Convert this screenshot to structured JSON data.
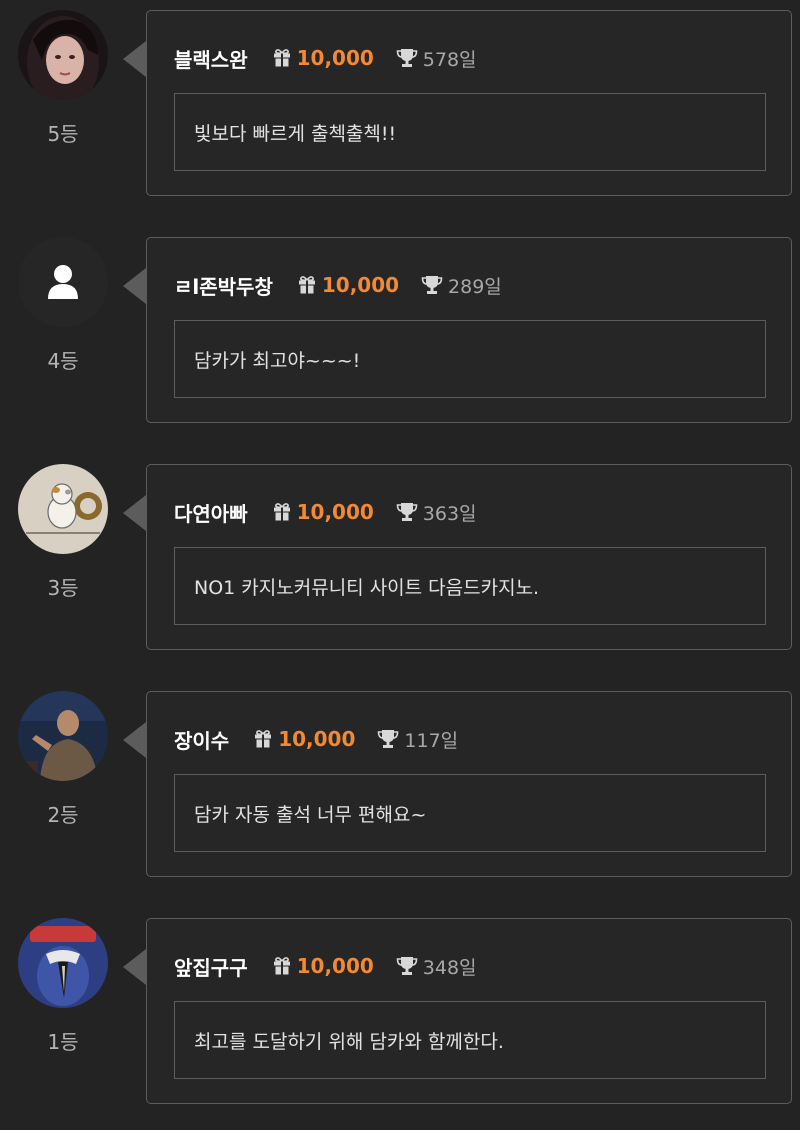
{
  "entries": [
    {
      "nickname": "블랙스완",
      "points": "10,000",
      "days": "578일",
      "message": "빛보다 빠르게 출첵출첵!!",
      "rank": "5등",
      "avatar": "photo-avatar"
    },
    {
      "nickname": "ㄹl존박두창",
      "points": "10,000",
      "days": "289일",
      "message": "담카가 최고야~~~!",
      "rank": "4등",
      "avatar": "default-user-avatar"
    },
    {
      "nickname": "다연아빠",
      "points": "10,000",
      "days": "363일",
      "message": "NO1 카지노커뮤니티 사이트 다음드카지노.",
      "rank": "3등",
      "avatar": "cartoon-avatar"
    },
    {
      "nickname": "장이수",
      "points": "10,000",
      "days": "117일",
      "message": "담카 자동 출석 너무 편해요~",
      "rank": "2등",
      "avatar": "photo-avatar"
    },
    {
      "nickname": "앞집구구",
      "points": "10,000",
      "days": "348일",
      "message": "최고를 도달하기 위해 담카와 함께한다.",
      "rank": "1등",
      "avatar": "cartoon-avatar"
    }
  ],
  "icons": {
    "points": "gift-icon",
    "days": "trophy-icon"
  },
  "colors": {
    "background": "#232323",
    "points": "#f28a35",
    "border": "#5c5c5c"
  }
}
